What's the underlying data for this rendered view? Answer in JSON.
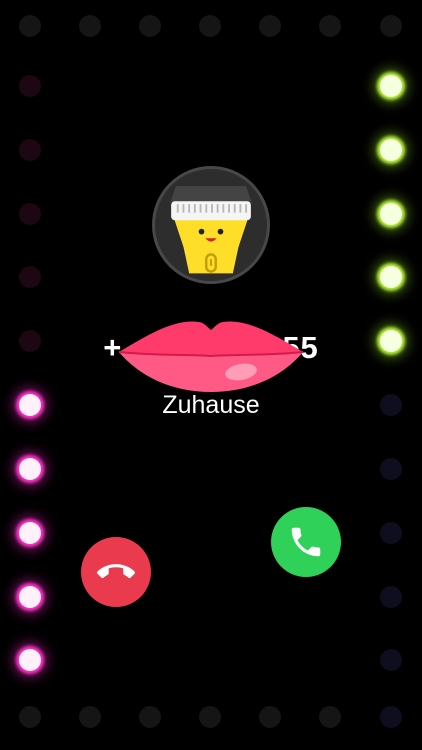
{
  "caller": {
    "number_prefix": "+",
    "number_suffix": "55",
    "label": "Zuhause",
    "avatar_icon": "flashlight-mascot-icon",
    "sticker_icon": "lips-sticker-icon"
  },
  "actions": {
    "decline_icon": "phone-hangup-icon",
    "accept_icon": "phone-icon"
  },
  "colors": {
    "background": "#000000",
    "decline": "#ea3a4d",
    "accept": "#2fd159",
    "light_green": "#b6f03a",
    "light_pink": "#ff34c8",
    "lips": "#ff3a6a"
  },
  "lights": {
    "left_column": [
      "off",
      "off",
      "off",
      "off",
      "off",
      "pink",
      "pink",
      "pink",
      "pink",
      "pink"
    ],
    "right_column": [
      "off",
      "green",
      "green",
      "green",
      "green",
      "green",
      "off",
      "off",
      "off",
      "off",
      "off"
    ]
  }
}
